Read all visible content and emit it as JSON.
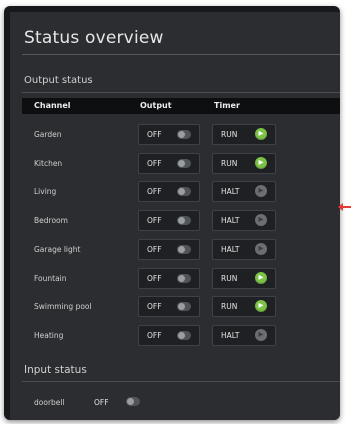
{
  "page": {
    "title": "Status overview"
  },
  "output_status": {
    "section_label": "Output status",
    "columns": {
      "channel": "Channel",
      "output": "Output",
      "timer": "Timer"
    },
    "rows": [
      {
        "channel": "Garden",
        "output": "OFF",
        "timer": "RUN"
      },
      {
        "channel": "Kitchen",
        "output": "OFF",
        "timer": "RUN"
      },
      {
        "channel": "Living",
        "output": "OFF",
        "timer": "HALT"
      },
      {
        "channel": "Bedroom",
        "output": "OFF",
        "timer": "HALT"
      },
      {
        "channel": "Garage light",
        "output": "OFF",
        "timer": "HALT"
      },
      {
        "channel": "Fountain",
        "output": "OFF",
        "timer": "RUN"
      },
      {
        "channel": "Swimming pool",
        "output": "OFF",
        "timer": "RUN"
      },
      {
        "channel": "Heating",
        "output": "OFF",
        "timer": "HALT"
      }
    ]
  },
  "input_status": {
    "section_label": "Input status",
    "items": [
      {
        "name": "doorbell",
        "state": "OFF"
      }
    ]
  },
  "icons": {
    "timer_run": "play-icon",
    "timer_halt": "play-icon-disabled",
    "toggle": "toggle-switch-icon"
  },
  "colors": {
    "run_indicator": "#7cc247",
    "halt_indicator": "#6b6e73",
    "header_bar": "#0e0f11",
    "panel_background": "#2b2d30",
    "annotation_arrow": "#e33b3b"
  }
}
